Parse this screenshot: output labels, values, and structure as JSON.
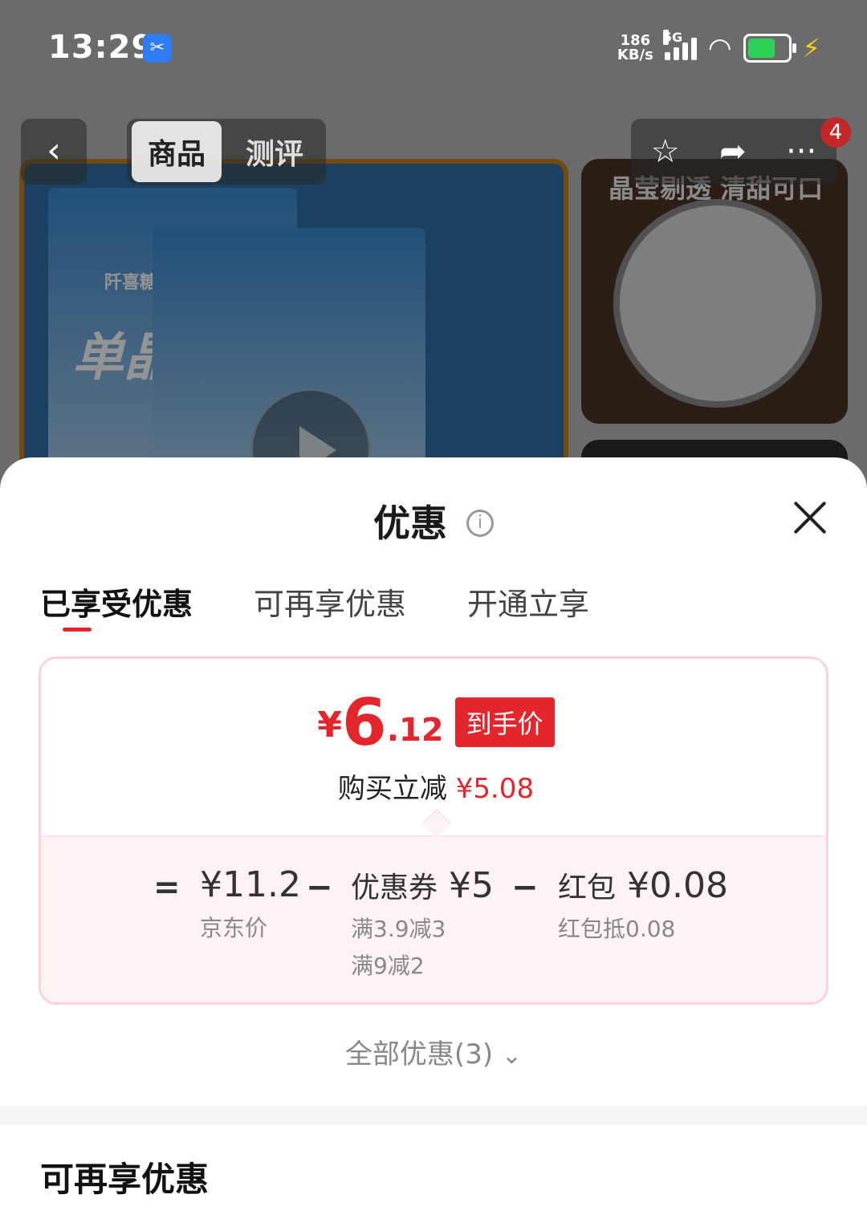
{
  "status_bar": {
    "time": "13:29",
    "net_speed_value": "186",
    "net_speed_unit": "KB/s",
    "network": "5G",
    "icons": [
      "app-notification-icon",
      "signal-icon",
      "wifi-icon",
      "battery-icon",
      "charging-bolt-icon"
    ]
  },
  "product_page": {
    "tabs": [
      "商品",
      "测评"
    ],
    "cart_badge": "4",
    "thumbnail_caption": "晶莹剔透 清甜可口",
    "pack_brand": "阡喜糖业",
    "pack_name": "单晶冰糖"
  },
  "sheet": {
    "title": "优惠",
    "tabs": [
      "已享受优惠",
      "可再享优惠",
      "开通立享"
    ],
    "active_tab": 0,
    "final_price": {
      "currency": "¥",
      "integer": "6",
      "decimal": ".12",
      "tag": "到手价"
    },
    "saving": {
      "label": "购买立减",
      "amount": "¥5.08"
    },
    "breakdown": {
      "equals": "=",
      "minus": "−",
      "base_price": {
        "value": "¥11.2",
        "sub": "京东价"
      },
      "coupon": {
        "label": "优惠券",
        "value": "¥5",
        "subs": [
          "满3.9减3",
          "满9减2"
        ]
      },
      "red_packet": {
        "label": "红包",
        "value": "¥0.08",
        "sub": "红包抵0.08"
      }
    },
    "all_offers": "全部优惠(3)",
    "section_title": "可再享优惠"
  },
  "colors": {
    "accent_red": "#e4262c",
    "card_border": "#fcd3dd",
    "breakdown_bg": "#fdf3f5"
  }
}
